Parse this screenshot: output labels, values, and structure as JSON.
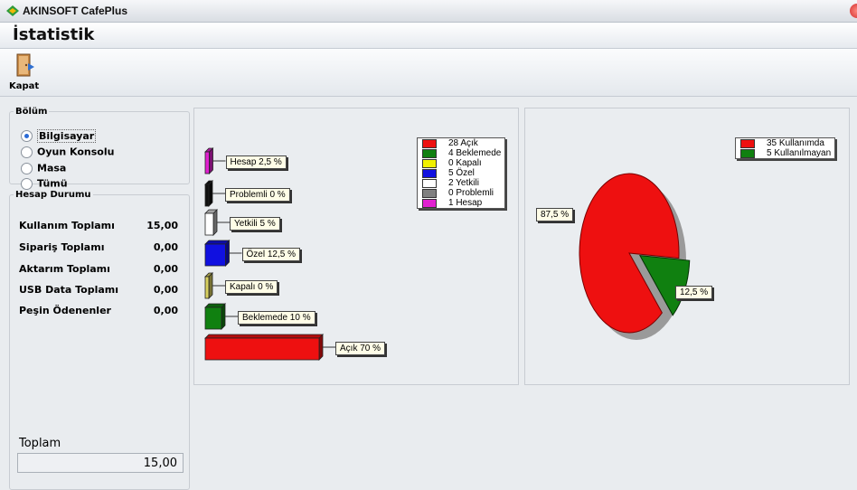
{
  "window": {
    "title": "AKINSOFT CafePlus"
  },
  "header": {
    "title": "İstatistik"
  },
  "toolbar": {
    "close_label": "Kapat"
  },
  "bolum": {
    "legend": "Bölüm",
    "options": [
      {
        "label": "Bilgisayar",
        "selected": true
      },
      {
        "label": "Oyun Konsolu",
        "selected": false
      },
      {
        "label": "Masa",
        "selected": false
      },
      {
        "label": "Tümü",
        "selected": false
      }
    ]
  },
  "hesap": {
    "legend": "Hesap Durumu",
    "rows": [
      {
        "label": "Kullanım Toplamı",
        "value": "15,00"
      },
      {
        "label": "Sipariş Toplamı",
        "value": "0,00"
      },
      {
        "label": "Aktarım Toplamı",
        "value": "0,00"
      },
      {
        "label": "USB Data Toplamı",
        "value": "0,00"
      },
      {
        "label": "Peşin Ödenenler",
        "value": "0,00"
      }
    ],
    "total_label": "Toplam",
    "total_value": "15,00"
  },
  "chart_data": [
    {
      "type": "bar",
      "orientation": "horizontal",
      "categories": [
        "Hesap",
        "Problemli",
        "Yetkili",
        "Özel",
        "Kapalı",
        "Beklemede",
        "Açık"
      ],
      "values": [
        2.5,
        0,
        5,
        12.5,
        0,
        10,
        70
      ],
      "bar_labels": [
        "Hesap 2,5 %",
        "Problemli 0 %",
        "Yetkili 5 %",
        "Özel 12,5 %",
        "Kapalı 0 %",
        "Beklemede 10 %",
        "Açık 70 %"
      ],
      "colors": [
        "#e020d0",
        "#111111",
        "#ffffff",
        "#1010e0",
        "#d8d060",
        "#108010",
        "#ee1010"
      ],
      "legend_position": "top-right",
      "legend": [
        {
          "text": "28 Açık",
          "color": "#ee1010"
        },
        {
          "text": "4 Beklemede",
          "color": "#108010"
        },
        {
          "text": "0 Kapalı",
          "color": "#f0f000"
        },
        {
          "text": "5 Özel",
          "color": "#1010e0"
        },
        {
          "text": "2 Yetkili",
          "color": "#ffffff"
        },
        {
          "text": "0 Problemli",
          "color": "#808080"
        },
        {
          "text": "1 Hesap",
          "color": "#e020d0"
        }
      ]
    },
    {
      "type": "pie",
      "categories": [
        "Kullanımda",
        "Kullanılmayan"
      ],
      "values": [
        87.5,
        12.5
      ],
      "slice_labels": [
        "87,5 %",
        "12,5 %"
      ],
      "colors": [
        "#ee1010",
        "#108010"
      ],
      "legend_position": "top-right",
      "legend": [
        {
          "text": "35 Kullanımda",
          "color": "#ee1010"
        },
        {
          "text": "5 Kullanılmayan",
          "color": "#108010"
        }
      ]
    }
  ]
}
